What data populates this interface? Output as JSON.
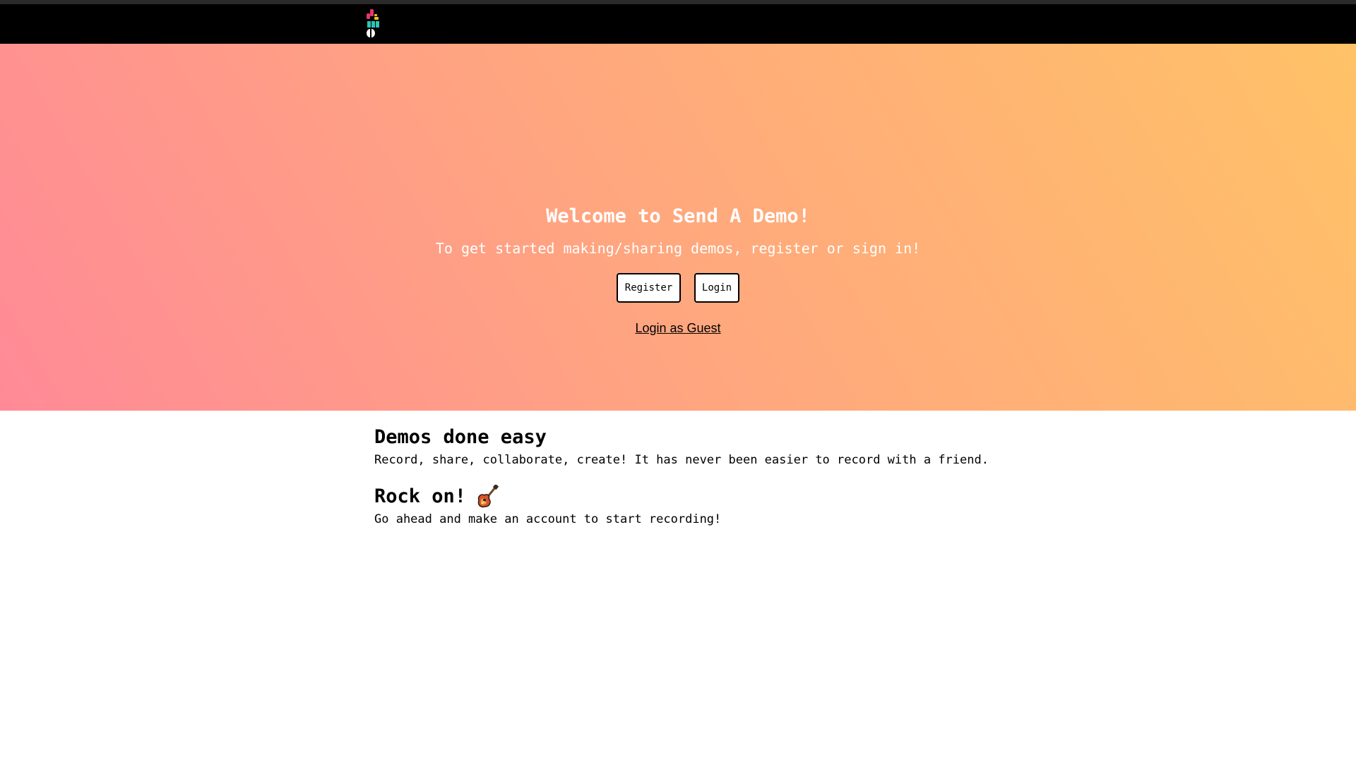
{
  "navbar": {
    "logo_icon": "send-a-demo-logo-icon"
  },
  "hero": {
    "title": "Welcome to Send A Demo!",
    "subtitle": "To get started making/sharing demos, register or sign in!",
    "register_label": "Register",
    "login_label": "Login",
    "guest_label": "Login as Guest",
    "gradient_colors": [
      "#ff8a97",
      "#ffa77e",
      "#ffc267"
    ]
  },
  "sections": [
    {
      "title": "Demos done easy",
      "text": "Record, share, collaborate, create! It has never been easier to record with a friend."
    },
    {
      "title": "Rock on!",
      "icon": "guitar-icon",
      "text": "Go ahead and make an account to start recording!"
    }
  ]
}
